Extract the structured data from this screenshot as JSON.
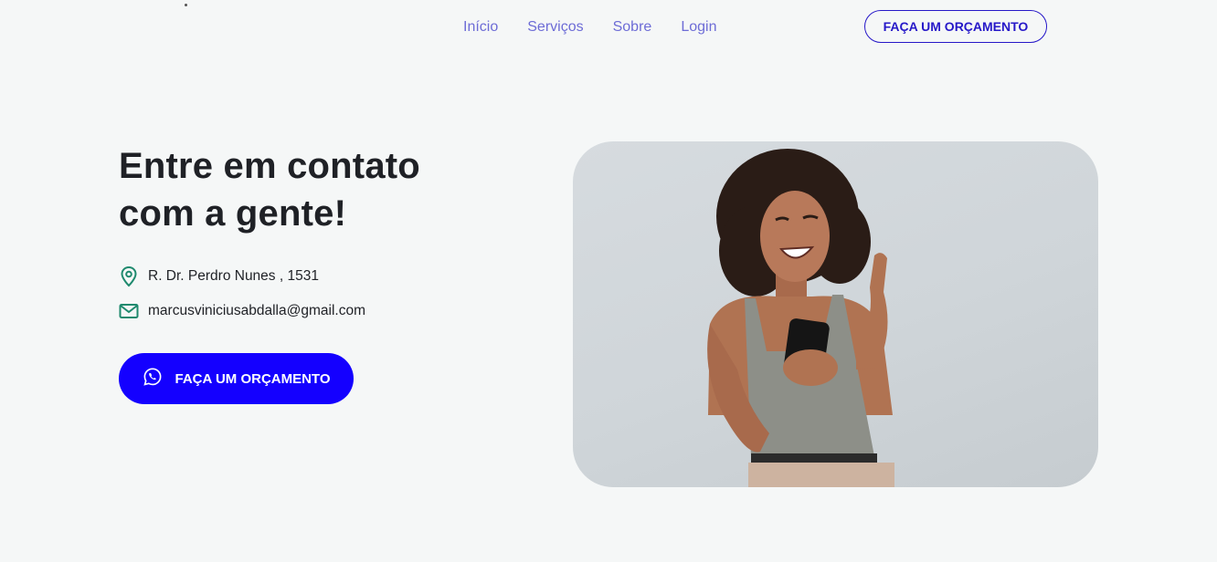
{
  "nav": {
    "items": [
      {
        "label": "Início"
      },
      {
        "label": "Serviços"
      },
      {
        "label": "Sobre"
      },
      {
        "label": "Login"
      }
    ],
    "cta_label": "FAÇA UM ORÇAMENTO"
  },
  "hero": {
    "title_line1": "Entre em contato",
    "title_line2": "com a gente!",
    "address": "R. Dr. Perdro Nunes , 1531",
    "email": "marcusviniciusabdalla@gmail.com",
    "cta_label": "FAÇA UM ORÇAMENTO",
    "cta_icon": "whatsapp-icon",
    "photo": "woman-smiling-holding-phone"
  },
  "colors": {
    "accent": "#1400ff",
    "nav_link": "#6d6cd6",
    "icon_green": "#1f8a6e",
    "background": "#f5f7f7"
  }
}
